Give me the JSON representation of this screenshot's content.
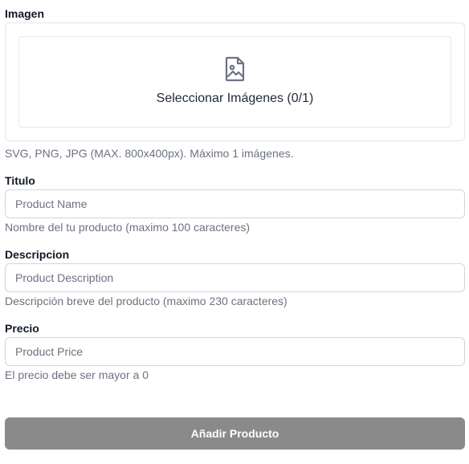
{
  "image": {
    "label": "Imagen",
    "dropzone_text": "Seleccionar Imágenes (0/1)",
    "hint": "SVG, PNG, JPG (MAX. 800x400px). Máximo 1 imágenes."
  },
  "title_field": {
    "label": "Titulo",
    "placeholder": "Product Name",
    "hint": "Nombre del tu producto (maximo 100 caracteres)"
  },
  "description_field": {
    "label": "Descripcion",
    "placeholder": "Product Description",
    "hint": "Descripción breve del producto (maximo 230 caracteres)"
  },
  "price_field": {
    "label": "Precio",
    "placeholder": "Product Price",
    "hint": "El precio debe ser mayor a 0"
  },
  "submit": {
    "label": "Añadir Producto"
  },
  "icons": {
    "dropzone_icon": "image-file-icon"
  },
  "colors": {
    "submit_bg": "#8a8a8a",
    "hint_text": "#6b7280",
    "border": "#d1d5db"
  }
}
